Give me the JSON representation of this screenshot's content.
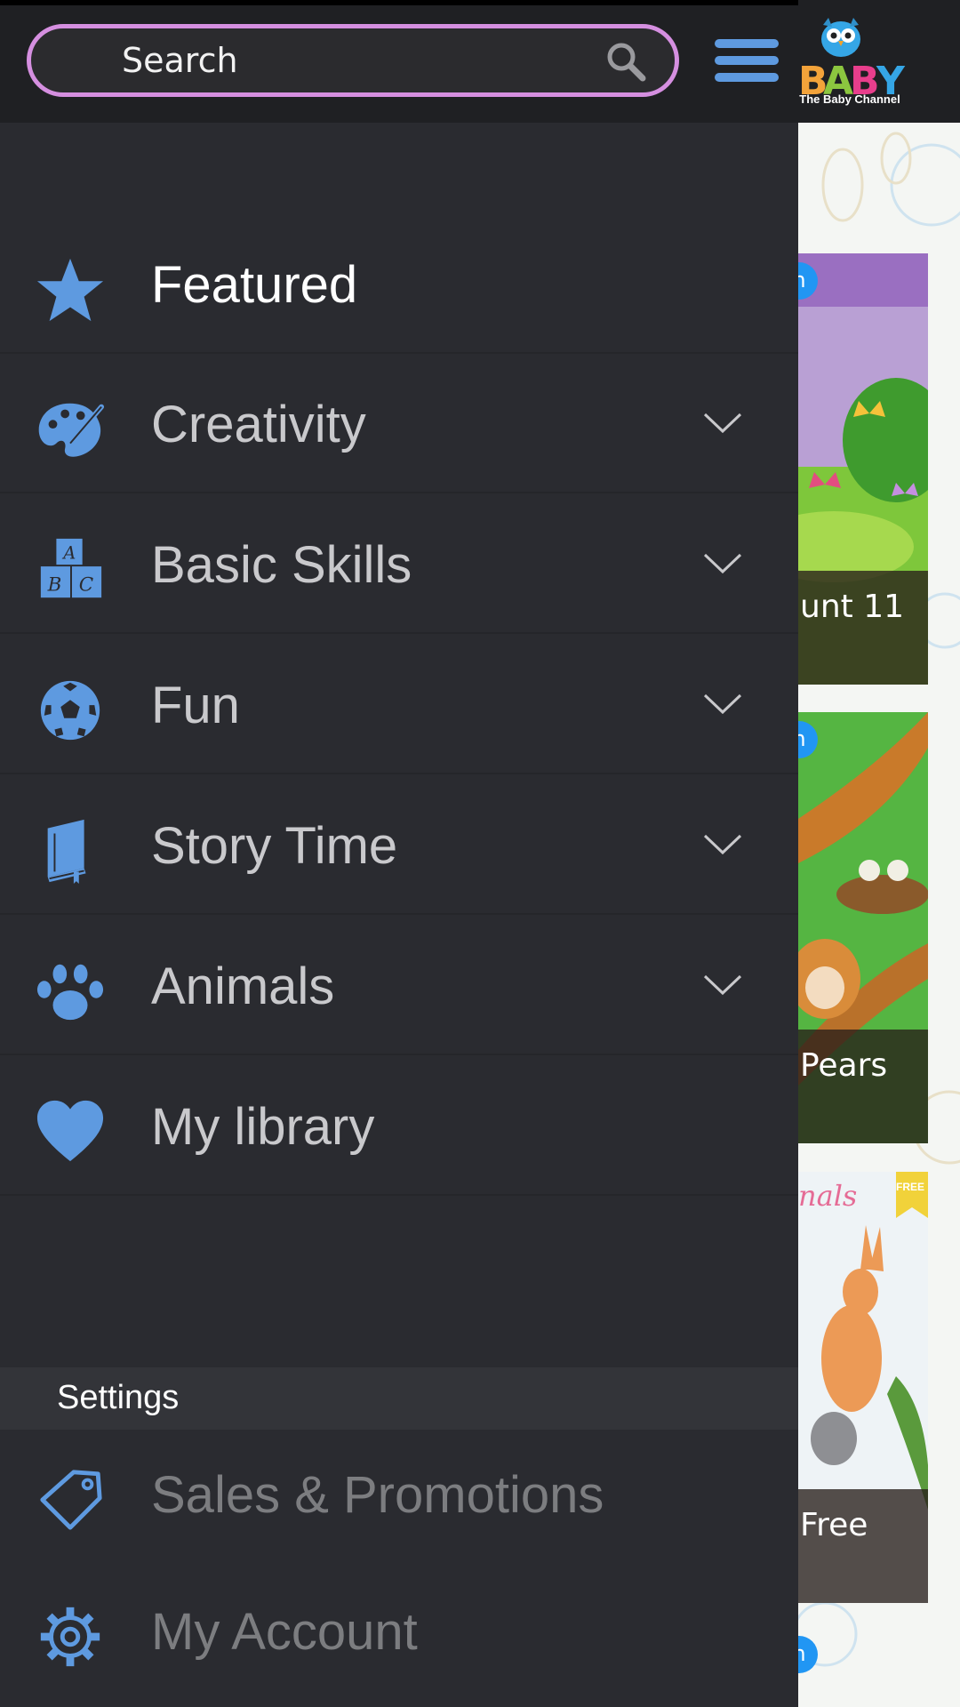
{
  "search": {
    "placeholder": "Search"
  },
  "brand": {
    "logo_text": "BABY",
    "tagline": "The Baby Channel"
  },
  "drawer": {
    "items": [
      {
        "label": "Featured",
        "icon": "star-icon",
        "expandable": false,
        "active": true
      },
      {
        "label": "Creativity",
        "icon": "palette-icon",
        "expandable": true
      },
      {
        "label": "Basic Skills",
        "icon": "abc-blocks-icon",
        "expandable": true
      },
      {
        "label": "Fun",
        "icon": "soccer-ball-icon",
        "expandable": true
      },
      {
        "label": "Story Time",
        "icon": "book-icon",
        "expandable": true
      },
      {
        "label": "Animals",
        "icon": "paw-icon",
        "expandable": true
      },
      {
        "label": "My library",
        "icon": "heart-icon",
        "expandable": false
      }
    ],
    "settings_header": "Settings",
    "settings": [
      {
        "label": "Sales & Promotions",
        "icon": "tag-icon"
      },
      {
        "label": "My Account",
        "icon": "gear-icon"
      }
    ]
  },
  "content": {
    "cards": [
      {
        "caption": "unt 11",
        "badge": "n"
      },
      {
        "caption": "Pears",
        "badge": "n"
      },
      {
        "caption": "Free",
        "title_fragment": "nals",
        "ribbon": "FREE"
      }
    ],
    "bottom_badge": "n"
  },
  "colors": {
    "accent": "#5e9ae0",
    "search_border": "#d58fe0",
    "drawer_bg": "#2a2b30"
  }
}
